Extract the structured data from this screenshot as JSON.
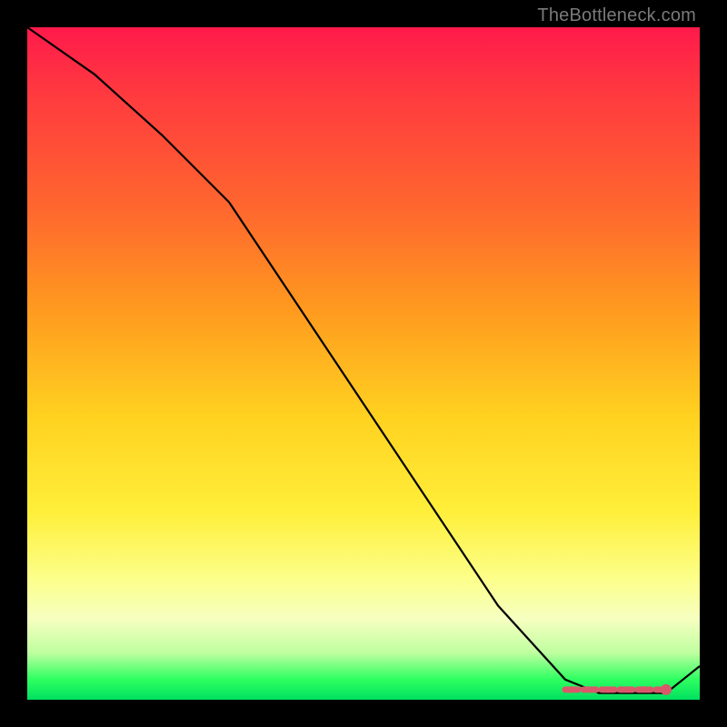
{
  "watermark": "TheBottleneck.com",
  "chart_data": {
    "type": "line",
    "title": "",
    "xlabel": "",
    "ylabel": "",
    "xlim": [
      0,
      100
    ],
    "ylim": [
      0,
      100
    ],
    "grid": false,
    "series": [
      {
        "name": "curve",
        "x": [
          0,
          10,
          20,
          30,
          40,
          50,
          60,
          70,
          80,
          85,
          90,
          95,
          100
        ],
        "y": [
          100,
          93,
          84,
          74,
          59,
          44,
          29,
          14,
          3,
          1,
          1,
          1,
          5
        ]
      }
    ],
    "highlight": {
      "name": "optimal-range",
      "x_start": 80,
      "x_end": 95,
      "y": 1.5,
      "endpoint": {
        "x": 95,
        "y": 1.5
      }
    },
    "gradient_stops": [
      {
        "pos": 0,
        "color": "#ff1a4b"
      },
      {
        "pos": 28,
        "color": "#ff6a2d"
      },
      {
        "pos": 58,
        "color": "#ffd220"
      },
      {
        "pos": 82,
        "color": "#fcff8a"
      },
      {
        "pos": 97,
        "color": "#2dff60"
      },
      {
        "pos": 100,
        "color": "#00e060"
      }
    ]
  }
}
